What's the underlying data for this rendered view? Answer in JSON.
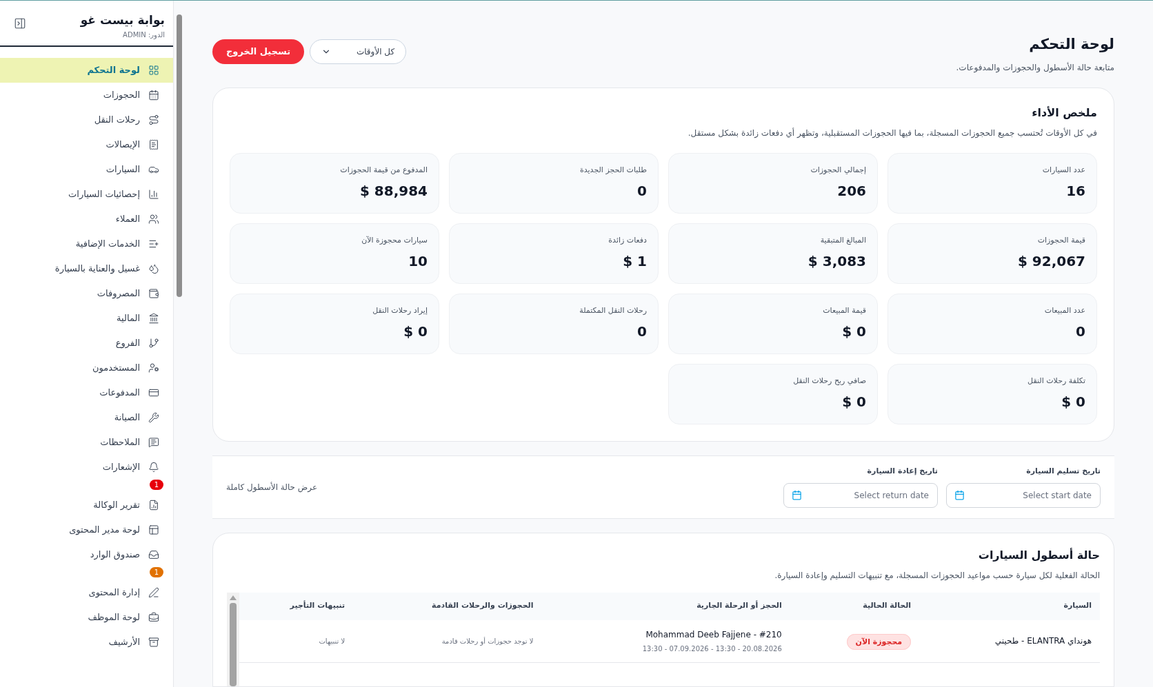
{
  "sidebar": {
    "title": "بوابة بيست غو",
    "role": "الدور: ADMIN",
    "items": [
      {
        "label": "لوحة التحكم",
        "selected": true
      },
      {
        "label": "الحجوزات",
        "selected": false
      },
      {
        "label": "رحلات النقل",
        "selected": false
      },
      {
        "label": "الإيصالات",
        "selected": false
      },
      {
        "label": "السيارات",
        "selected": false
      },
      {
        "label": "إحصائيات السيارات",
        "selected": false
      },
      {
        "label": "العملاء",
        "selected": false
      },
      {
        "label": "الخدمات الإضافية",
        "selected": false
      },
      {
        "label": "غسيل والعناية بالسيارة",
        "selected": false
      },
      {
        "label": "المصروفات",
        "selected": false
      },
      {
        "label": "المالية",
        "selected": false
      },
      {
        "label": "الفروع",
        "selected": false
      },
      {
        "label": "المستخدمون",
        "selected": false
      },
      {
        "label": "المدفوعات",
        "selected": false
      },
      {
        "label": "الصيانة",
        "selected": false
      },
      {
        "label": "الملاحظات",
        "selected": false
      },
      {
        "label": "الإشعارات",
        "selected": false,
        "badge": {
          "text": "1",
          "color": "#e7000b"
        }
      },
      {
        "label": "تقرير الوكالة",
        "selected": false
      },
      {
        "label": "لوحة مدير المحتوى",
        "selected": false
      },
      {
        "label": "صندوق الوارد",
        "selected": false,
        "badge": {
          "text": "1",
          "color": "#e17100"
        }
      },
      {
        "label": "إدارة المحتوى",
        "selected": false
      },
      {
        "label": "لوحة الموظف",
        "selected": false
      },
      {
        "label": "الأرشيف",
        "selected": false
      }
    ]
  },
  "header": {
    "title": "لوحة التحكم",
    "subtitle": "متابعة حالة الأسطول والحجوزات والمدفوعات.",
    "period": "كل الأوقات",
    "logout": "تسجيل الخروج"
  },
  "summary": {
    "title": "ملخص الأداء",
    "note": "في كل الأوقات تُحتسب جميع الحجوزات المسجلة، بما فيها الحجوزات المستقبلية، وتظهر أي دفعات زائدة بشكل مستقل.",
    "stats": [
      {
        "label": "عدد السيارات",
        "value": "16"
      },
      {
        "label": "إجمالي الحجوزات",
        "value": "206"
      },
      {
        "label": "طلبات الحجز الجديدة",
        "value": "0"
      },
      {
        "label": "المدفوع من قيمة الحجوزات",
        "value": "$ 88,984"
      },
      {
        "label": "قيمة الحجوزات",
        "value": "$ 92,067"
      },
      {
        "label": "المبالغ المتبقية",
        "value": "$ 3,083"
      },
      {
        "label": "دفعات زائدة",
        "value": "$ 1"
      },
      {
        "label": "سيارات محجوزة الآن",
        "value": "10"
      },
      {
        "label": "عدد المبيعات",
        "value": "0"
      },
      {
        "label": "قيمة المبيعات",
        "value": "$ 0"
      },
      {
        "label": "رحلات النقل المكتملة",
        "value": "0"
      },
      {
        "label": "إيراد رحلات النقل",
        "value": "$ 0"
      },
      {
        "label": "تكلفة رحلات النقل",
        "value": "$ 0"
      },
      {
        "label": "صافي ربح رحلات النقل",
        "value": "$ 0"
      }
    ]
  },
  "filter": {
    "start_label": "تاريخ تسليم السيارة",
    "start_placeholder": "Select start date",
    "return_label": "تاريخ إعادة السيارة",
    "return_placeholder": "Select return date",
    "link": "عرض حالة الأسطول كاملة"
  },
  "fleet": {
    "title": "حالة أسطول السيارات",
    "subtitle": "الحالة الفعلية لكل سيارة حسب مواعيد الحجوزات المسجلة، مع تنبيهات التسليم وإعادة السيارة.",
    "columns": [
      "السيارة",
      "الحالة الحالية",
      "الحجز أو الرحلة الجارية",
      "الحجوزات والرحلات القادمة",
      "تنبيهات التأجير"
    ],
    "rows": [
      {
        "car": "هونداي ELANTRA - طحيني",
        "status": "محجوزة الآن",
        "booking": "#210 - Mohammad Deeb Fajjene",
        "dates": "20.08.2026 - 13:30 - 07.09.2026 - 13:30",
        "upcoming": "لا توجد حجوزات أو رحلات قادمة",
        "alerts": "لا تنبيهات"
      }
    ]
  }
}
